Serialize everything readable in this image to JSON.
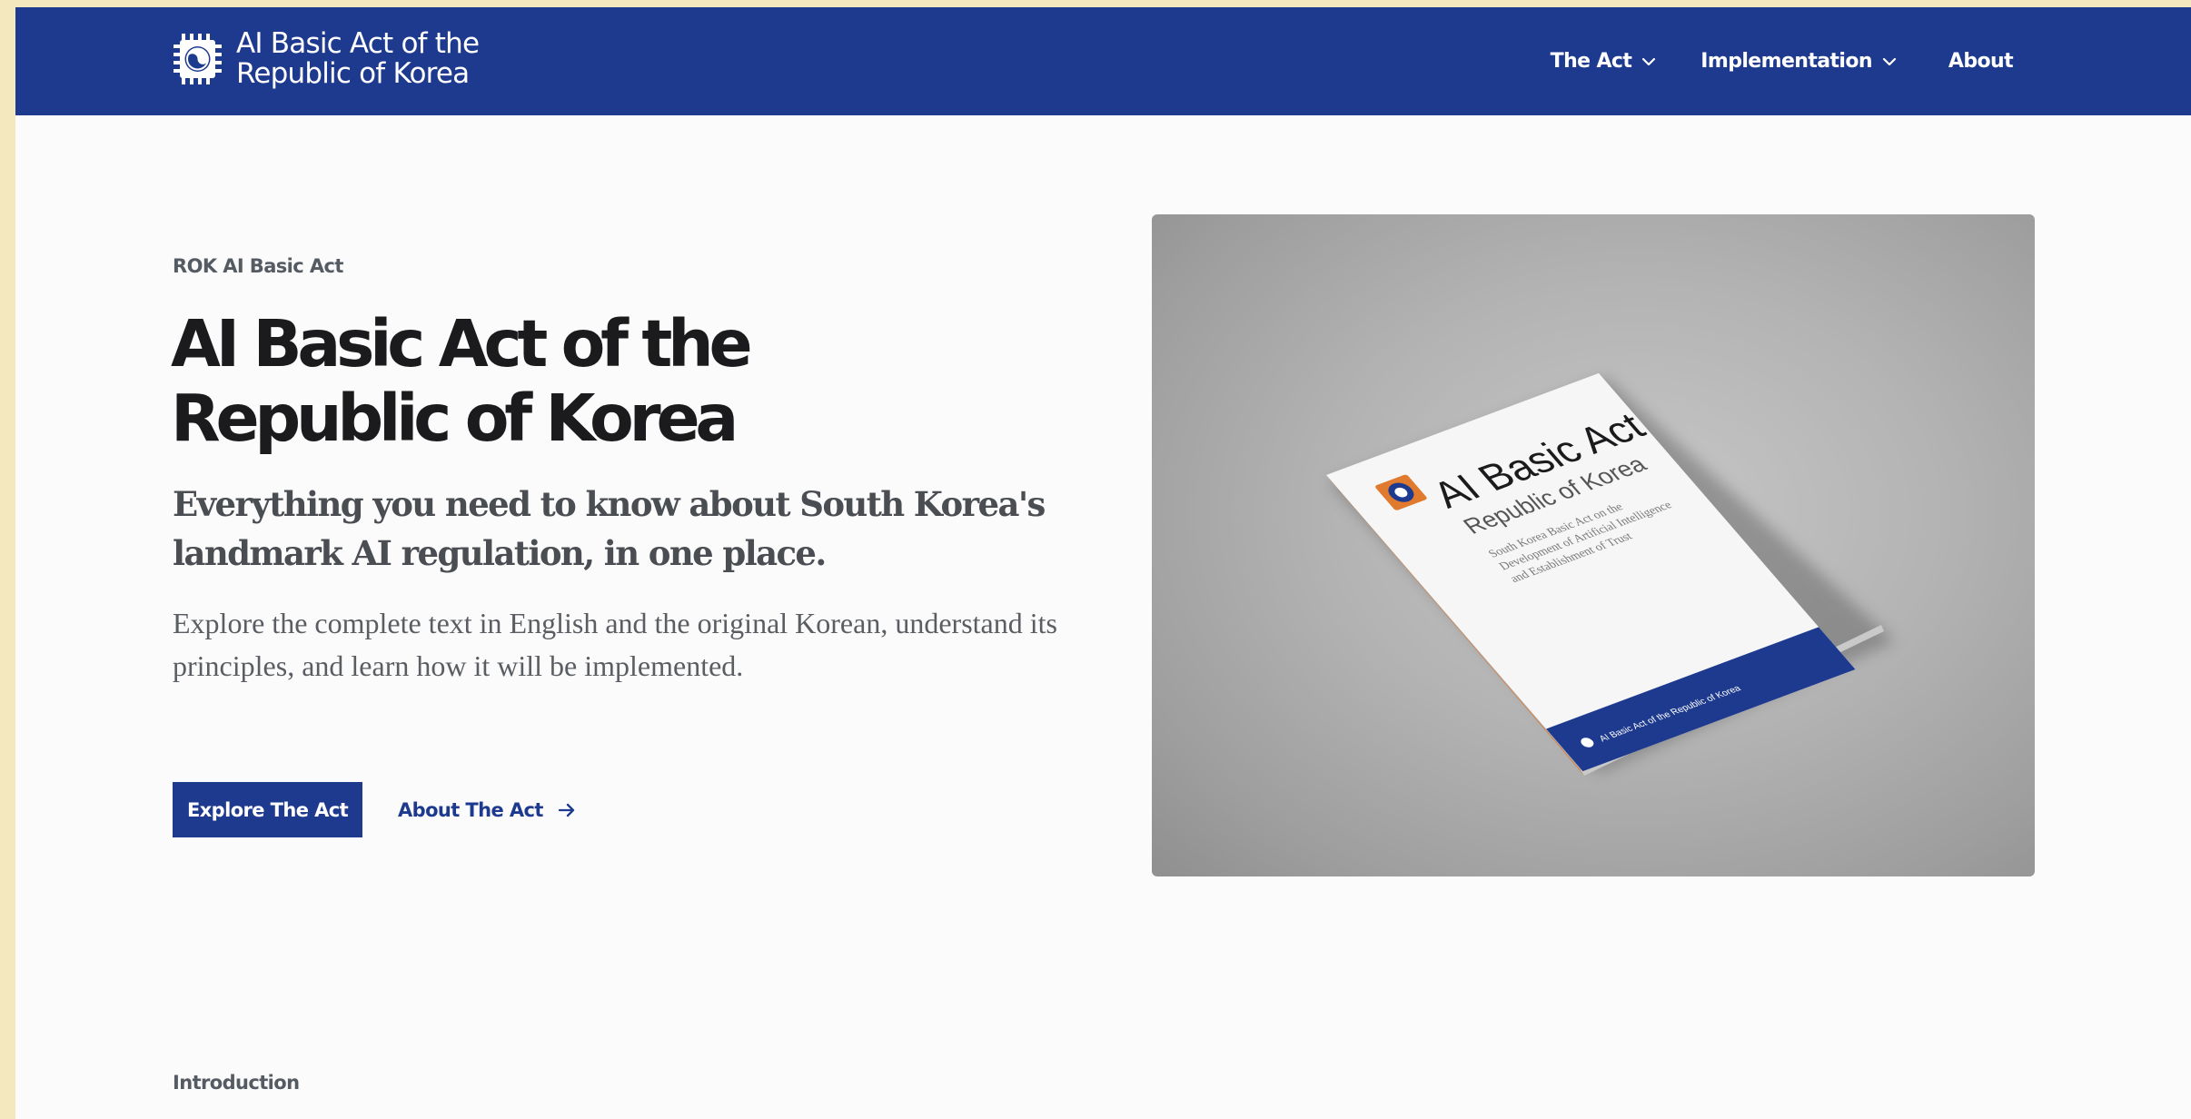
{
  "header": {
    "brand_title": "AI Basic Act of the Republic of Korea",
    "brand_logo_icon": "chip-taegeuk-icon",
    "nav": [
      {
        "label": "The Act",
        "icon": "chevron-down-icon"
      },
      {
        "label": "Implementation",
        "icon": "chevron-down-icon"
      },
      {
        "label": "About"
      }
    ]
  },
  "hero": {
    "eyebrow": "ROK AI Basic Act",
    "title": "AI Basic Act of the Republic of Korea",
    "subtitle": "Everything you need to know about South Korea's landmark AI regulation, in one place.",
    "body": "Explore the complete text in English and the original Korean, understand its principles, and learn how it will be implemented.",
    "primary_cta": "Explore The Act",
    "secondary_cta": "About The Act",
    "secondary_cta_icon": "arrow-right-icon",
    "image": {
      "cover_title": "AI Basic Act",
      "cover_subtitle": "Republic of Korea",
      "cover_text_1": "South Korea Basic Act on the",
      "cover_text_2": "Development of Artificial Intelligence",
      "cover_text_3": "and Establishment of Trust",
      "cover_footer": "AI Basic Act of the Republic of Korea"
    }
  },
  "intro": {
    "label": "Introduction"
  },
  "colors": {
    "brand_blue": "#1e3a8f",
    "page_background": "#fbfbfb",
    "outer_background": "#f4e8bf",
    "accent_orange": "#e07a2e"
  }
}
